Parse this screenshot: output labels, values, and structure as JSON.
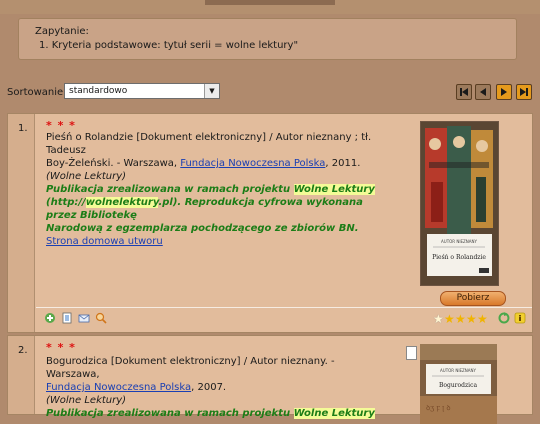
{
  "query": {
    "label": "Zapytanie:",
    "criteria": "1. Kryteria podstawowe: tytuł serii = wolne lektury\""
  },
  "sort": {
    "label": "Sortowanie:",
    "selected": "standardowo"
  },
  "pagination": {
    "first_icon": "first-page-icon",
    "prev_icon": "prev-page-icon",
    "next_icon": "next-page-icon",
    "last_icon": "last-page-icon"
  },
  "records": [
    {
      "number": "1.",
      "marker": "* * *",
      "title_line1": "Pieśń o Rolandzie [Dokument elektroniczny] / Autor nieznany ; tł. Tadeusz",
      "title_line2_prefix": "Boy-Żeleński. - Warszawa, ",
      "publisher_link": "Fundacja Nowoczesna Polska",
      "title_line2_suffix": ", 2011.",
      "series": "(Wolne Lektury)",
      "note_prefix": "Publikacja zrealizowana w ramach projektu ",
      "note_highlight1": "Wolne Lektury",
      "note_line2_prefix": "(http://",
      "note_highlight2": "wolnelektury",
      "note_line2_suffix": ".pl). Reprodukcja cyfrowa wykonana przez Bibliotekę",
      "note_line3": "Narodową z egzemplarza pochodzącego ze zbiorów BN.",
      "homepage_link": "Strona domowa utworu",
      "cover_author": "AUTOR NIEZNANY",
      "cover_title": "Pieśń o Rolandzie",
      "download_label": "Pobierz",
      "rating": 4
    },
    {
      "number": "2.",
      "marker": "* * *",
      "title_line1": "Bogurodzica [Dokument elektroniczny] / Autor nieznany. - Warszawa,",
      "publisher_link": "Fundacja Nowoczesna Polska",
      "title_line2_suffix": ", 2007.",
      "series": "(Wolne Lektury)",
      "note_prefix": "Publikacja zrealizowana w ramach projektu ",
      "note_highlight1": "Wolne Lektury",
      "cover_author": "AUTOR NIEZNANY",
      "cover_title": "Bogurodzica"
    }
  ],
  "colors": {
    "background": "#b08a6d",
    "record_bg": "#e2bc9c",
    "green_note": "#1c7d17",
    "highlight": "#f4fb97",
    "link": "#1a3fb3",
    "marker_red": "#d11111",
    "nav_active": "#e59a1c"
  }
}
